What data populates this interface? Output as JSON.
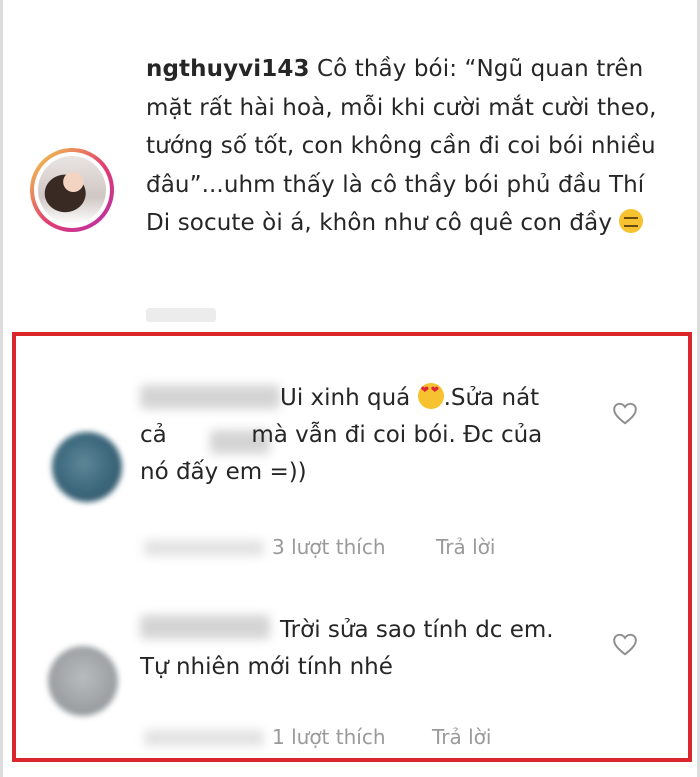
{
  "post": {
    "username": "ngthuyvi143",
    "caption": "Cô thầy bói: “Ngũ quan trên mặt rất hài hoà, mỗi khi cười mắt cười theo, tướng số tốt, con không cần đi coi bói nhiều đâu”...uhm thấy là cô thầy bói phủ đầu Thí Di socute òi á, khôn như cô quê con đầy",
    "caption_emoji": "expressionless-face-emoji"
  },
  "comments": [
    {
      "text_part1": "Ui xinh quá",
      "emoji": "heart-eyes-emoji",
      "text_part2": ".Sửa nát cả",
      "text_part3": "mà vẫn đi coi bói. Đc của nó đấy em =))",
      "likes": "3 lượt thích",
      "reply": "Trả lời"
    },
    {
      "text": "Trời sửa sao tính dc em. Tự nhiên mới tính nhé",
      "likes": "1 lượt thích",
      "reply": "Trả lời"
    }
  ],
  "colors": {
    "highlight_border": "#d8262a",
    "meta_text": "#9a9a9a",
    "text": "#262626"
  },
  "icons": {
    "like": "heart-outline-icon"
  }
}
